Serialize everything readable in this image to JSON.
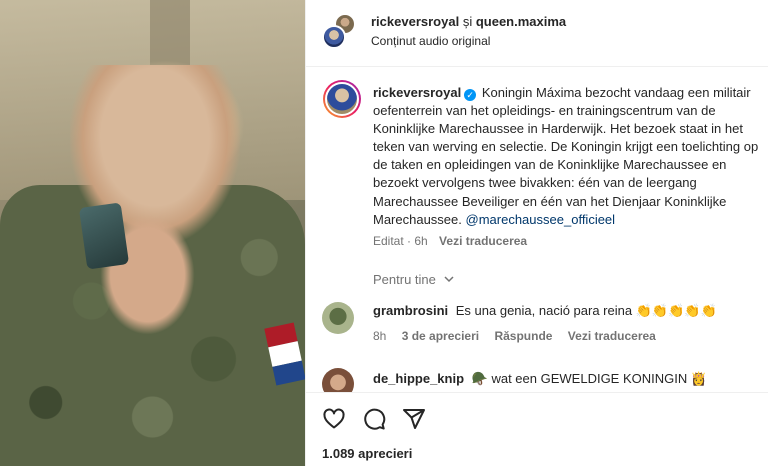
{
  "header": {
    "user1": "rickeversroyal",
    "separator": "și",
    "user2": "queen.maxima",
    "subtitle": "Conținut audio original"
  },
  "caption": {
    "username": "rickeversroyal",
    "text": "Koningin Máxima bezocht vandaag een militair oefenterrein van het opleidings- en trainingscentrum van de Koninklijke Marechaussee in Harderwijk. Het bezoek staat in het teken van werving en selectie. De Koningin krijgt een toelichting op de taken en opleidingen van de Koninklijke Marechaussee en bezoekt vervolgens twee bivakken: één van de leergang Marechaussee Beveiliger en één van het Dienjaar Koninklijke Marechaussee.",
    "mention": "@marechaussee_officieel",
    "edited": "Editat · 6h",
    "translate": "Vezi traducerea"
  },
  "for_you": "Pentru tine",
  "comments": [
    {
      "username": "grambrosini",
      "text": "Es una genia, nació para reina",
      "emoji": "👏👏👏👏👏",
      "time": "8h",
      "likes": "3 de aprecieri",
      "reply": "Răspunde",
      "translate": "Vezi traducerea"
    },
    {
      "username": "de_hippe_knip",
      "emoji_prefix": "🪖",
      "text": "wat een GEWELDIGE KONINGIN",
      "emoji": "👸"
    }
  ],
  "likes_count": "1.089 aprecieri",
  "colors": {
    "verified": "#0095f6",
    "mention": "#00376b",
    "muted": "#737373",
    "flag_red": "#ae1c28",
    "flag_white": "#ffffff",
    "flag_blue": "#21468b"
  },
  "icons": [
    "heart-icon",
    "comment-icon",
    "share-icon",
    "verified-icon",
    "chevron-down-icon"
  ]
}
